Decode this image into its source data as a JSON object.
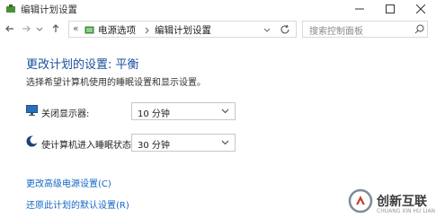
{
  "window": {
    "title": "编辑计划设置"
  },
  "breadcrumb": {
    "overflow": "«",
    "items": [
      "电源选项",
      "编辑计划设置"
    ]
  },
  "search": {
    "placeholder": "搜索控制面板"
  },
  "main": {
    "heading": "更改计划的设置: 平衡",
    "description": "选择希望计算机使用的睡眠设置和显示设置。",
    "settings": [
      {
        "label": "关闭显示器:",
        "value": "10 分钟",
        "icon": "monitor-icon"
      },
      {
        "label": "使计算机进入睡眠状态:",
        "value": "30 分钟",
        "icon": "moon-icon"
      }
    ],
    "links": [
      "更改高级电源设置(C)",
      "还原此计划的默认设置(R)"
    ]
  },
  "watermark": {
    "brand": "创新互联",
    "sub": "CHUANG XIN HU LIAN"
  },
  "colors": {
    "heading": "#1b4f9c",
    "link": "#1467c4",
    "border": "#d9d9d9"
  }
}
